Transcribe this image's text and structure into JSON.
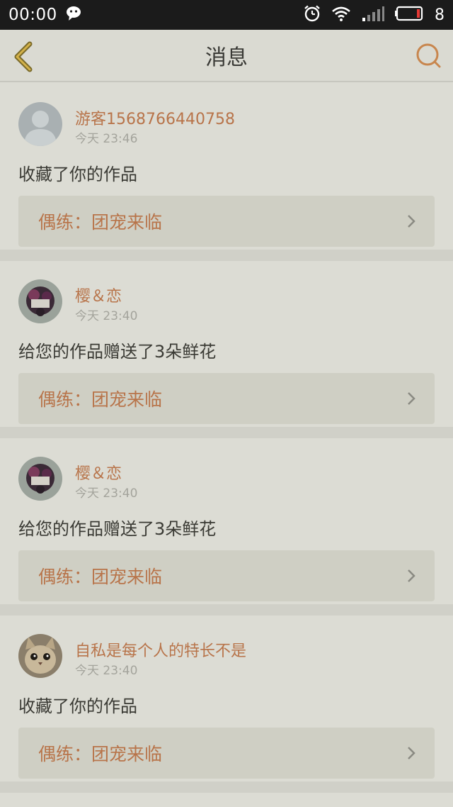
{
  "status_bar": {
    "time": "00:00",
    "battery": "8"
  },
  "header": {
    "title": "消息"
  },
  "colors": {
    "accent": "#b8744a",
    "background": "#dcdcd4",
    "status_bar": "#1b1b1b"
  },
  "messages": [
    {
      "user": "游客1568766440758",
      "time": "今天 23:46",
      "action": "收藏了你的作品",
      "work": "偶练：团宠来临",
      "avatar": "default-avatar-icon"
    },
    {
      "user": "樱＆恋",
      "time": "今天 23:40",
      "action": "给您的作品赠送了3朵鲜花",
      "work": "偶练：团宠来临",
      "avatar": "user-photo"
    },
    {
      "user": "樱＆恋",
      "time": "今天 23:40",
      "action": "给您的作品赠送了3朵鲜花",
      "work": "偶练：团宠来临",
      "avatar": "user-photo"
    },
    {
      "user": "自私是每个人的特长不是",
      "time": "今天 23:40",
      "action": "收藏了你的作品",
      "work": "偶练：团宠来临",
      "avatar": "cat-photo"
    }
  ]
}
